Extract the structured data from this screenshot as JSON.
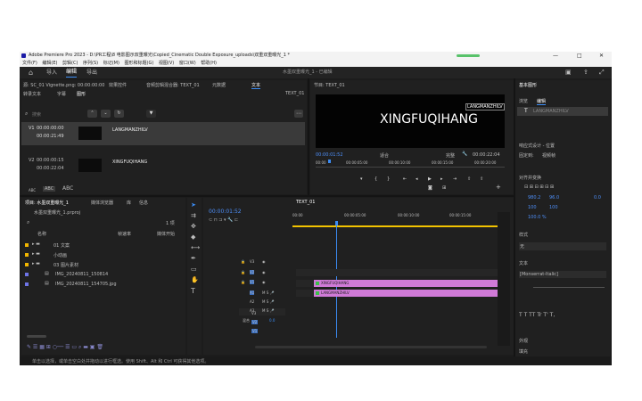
{
  "app": {
    "title": "Adobe Premiere Pro 2023 - D:\\PR工程\\8 电影图示双重曝光\\Copied_Cinematic Double Exposure_uploads\\双重双重曝光_1 *",
    "window_controls": [
      "—",
      "□",
      "✕"
    ]
  },
  "menu": [
    "文件(F)",
    "编辑(E)",
    "剪辑(C)",
    "序列(S)",
    "标记(M)",
    "图形和标题(G)",
    "视图(V)",
    "窗口(W)",
    "帮助(H)"
  ],
  "workspace": {
    "tabs": [
      "导入",
      "编辑",
      "导出"
    ],
    "active_tab": "编辑",
    "project_title": "水墨双重曝光_1 - 已编辑"
  },
  "source_panel": {
    "header": "源: SC_01 Vignette.png: 00:00:00:00",
    "tabs": [
      "效果控件",
      "音频剪辑混合器: TEXT_01",
      "元数据",
      "文本"
    ],
    "active_tab": "文本",
    "sequence": "TEXT_01",
    "subtabs": [
      "转录文本",
      "字幕",
      "图形"
    ],
    "active_subtab": "图形",
    "search_placeholder": "搜索",
    "layers": [
      {
        "time_start": "00:00:00:00",
        "time_end": "00:00:21:49",
        "label": "V1",
        "name": "LANGMANZHILV"
      },
      {
        "time_start": "00:00:00:15",
        "time_end": "00:00:22:04",
        "label": "V2",
        "name": "XINGFUQIHANG"
      }
    ],
    "text_styles": [
      "ABC",
      "ABC",
      "ABC"
    ]
  },
  "program_monitor": {
    "header": "节目: TEXT_01",
    "big_text": "XINGFUQIHANG",
    "small_text": "LANGMANZHILV",
    "timecode": "00:00:01:52",
    "fit": "适合",
    "quality": "完整",
    "duration": "00:00:22:04",
    "ruler": [
      "00:00",
      "00:00:05:00",
      "00:00:10:00",
      "00:00:15:00",
      "00:00:20:00"
    ]
  },
  "essential_graphics": {
    "header": "基本图形",
    "tabs": [
      "浏览",
      "编辑"
    ],
    "active_tab": "编辑",
    "layer_name": "LANGMANZHILV",
    "section_align": "响应式设计 - 位置",
    "pin_to": "固定到:",
    "pin_value": "视频帧",
    "section_align2": "对齐并变换",
    "x_value": "980.2",
    "y_value": "96.0",
    "rotation": "0.0",
    "scale_w": "100",
    "scale_h": "100",
    "opacity": "100.0 %",
    "section_style": "样式",
    "style_value": "无",
    "section_text": "文本",
    "font": "[Monserrat-Italic]",
    "section_appearance": "外观",
    "appearance_item": "填充"
  },
  "project_panel": {
    "tabs": [
      "项目: 水墨双重曝光_1",
      "媒体浏览器",
      "库",
      "信息"
    ],
    "active_tab": "项目: 水墨双重曝光_1",
    "file": "水墨双重曝光_1.prproj",
    "count": "1 项",
    "columns": [
      "名称",
      "帧速率",
      "媒体开始"
    ],
    "items": [
      {
        "name": "01 文案",
        "type": "folder",
        "color": "#f2b600"
      },
      {
        "name": "小动画",
        "type": "folder",
        "color": "#f2b600"
      },
      {
        "name": "03 图片素材",
        "type": "folder",
        "color": "#f2b600"
      },
      {
        "name": "IMG_20240811_150814",
        "type": "file",
        "color": "#6e74e6"
      },
      {
        "name": "IMG_20240811_154705.jpg",
        "type": "file",
        "color": "#6e74e6"
      }
    ]
  },
  "timeline": {
    "tabs": [
      "TEXT_01"
    ],
    "timecode": "00:00:01:52",
    "ruler": [
      "00:00",
      "00:00:05:00",
      "00:00:10:00",
      "00:00:15:00",
      "00:00:20:00"
    ],
    "video_tracks": [
      "V3",
      "V2",
      "V1"
    ],
    "audio_tracks": [
      "A1",
      "A2",
      "A3"
    ],
    "master": "混合",
    "master_value": "0.0",
    "clips": [
      {
        "name": "XINGFUQIHANG",
        "track": "V2",
        "start": 0.15,
        "end": 22.04
      },
      {
        "name": "LANGMANZHILV",
        "track": "V1",
        "start": 0.0,
        "end": 21.49
      }
    ]
  },
  "status": "单击以选择，或单击空白处并拖动以进行框选。使用 Shift、Alt 和 Ctrl 可获得其他选项。"
}
